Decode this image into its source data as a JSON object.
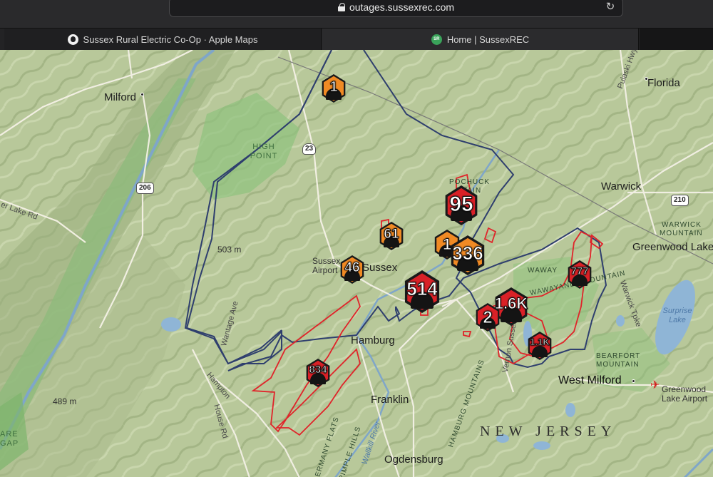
{
  "browser": {
    "url": "outages.sussexrec.com",
    "tabs": [
      {
        "title": "Sussex Rural Electric Co-Op · Apple Maps",
        "favicon": "apple-icon",
        "active": true
      },
      {
        "title": "Home | SussexREC",
        "favicon": "sussexrec-icon",
        "active": false
      }
    ]
  },
  "map": {
    "places": {
      "milford": "Milford",
      "florida": "Florida",
      "warwick": "Warwick",
      "greenwood_lake": "Greenwood Lake",
      "sussex": "Sussex",
      "sussex_airport": "Sussex Airport",
      "hamburg": "Hamburg",
      "franklin": "Franklin",
      "ogdensburg": "Ogdensburg",
      "west_milford": "West Milford",
      "greenwood_lake_airport": "Greenwood Lake Airport",
      "high_point": "HIGH POINT",
      "state": "NEW JERSEY",
      "wawayanda_left": "WAWAY",
      "wawayanda_mtn": "WAWAYANDA MOUNTAIN",
      "warwick_mtn_1": "WARWICK",
      "warwick_mtn_2": "MOUNTAIN",
      "bearfort_mtn": "BEARFORT MOUNTAIN",
      "pochuck_mtn": "POCHUCK MTAIN",
      "hamburg_mtns": "HAMBURG MOUNTAINS",
      "germany_flats": "GERMANY FLATS",
      "simple_hills": "PIMPLE HILLS",
      "walkill_river": "Wallkill River",
      "surprise_lake": "Surprise Lake",
      "elev_503": "503 m",
      "elev_489": "489 m",
      "lake_rd": "er Lake Rd",
      "pulaski_hwy": "Pulaski Hwy",
      "hampton": "Hampton",
      "house_rd": "House Rd",
      "vernon_sussex": "Vernon Sussex",
      "warwick_tpke": "Warwick Tpke",
      "wantage_ave": "Wantage Ave",
      "gap_left": "ARE GAP"
    },
    "routes": {
      "r206": "206",
      "r23": "23",
      "r210": "210"
    },
    "colors": {
      "territory_border": "#2f3f6e",
      "outage_area": "#e0242a",
      "marker_red": "#d92127",
      "marker_orange": "#f08a24"
    }
  },
  "outage_markers": [
    {
      "id": "m1",
      "count": "1",
      "color": "orange"
    },
    {
      "id": "m95",
      "count": "95",
      "color": "red"
    },
    {
      "id": "m61",
      "count": "61",
      "color": "orange"
    },
    {
      "id": "m1b",
      "count": "1",
      "color": "orange"
    },
    {
      "id": "m336",
      "count": "336",
      "color": "orange"
    },
    {
      "id": "m46",
      "count": "46",
      "color": "orange"
    },
    {
      "id": "m514",
      "count": "514",
      "color": "red"
    },
    {
      "id": "m777",
      "count": "777",
      "color": "red"
    },
    {
      "id": "m1_6k",
      "count": "1.6K",
      "color": "red"
    },
    {
      "id": "m2",
      "count": "2",
      "color": "red"
    },
    {
      "id": "m1_1k",
      "count": "1.1K",
      "color": "red"
    },
    {
      "id": "m834",
      "count": "834",
      "color": "red"
    }
  ]
}
